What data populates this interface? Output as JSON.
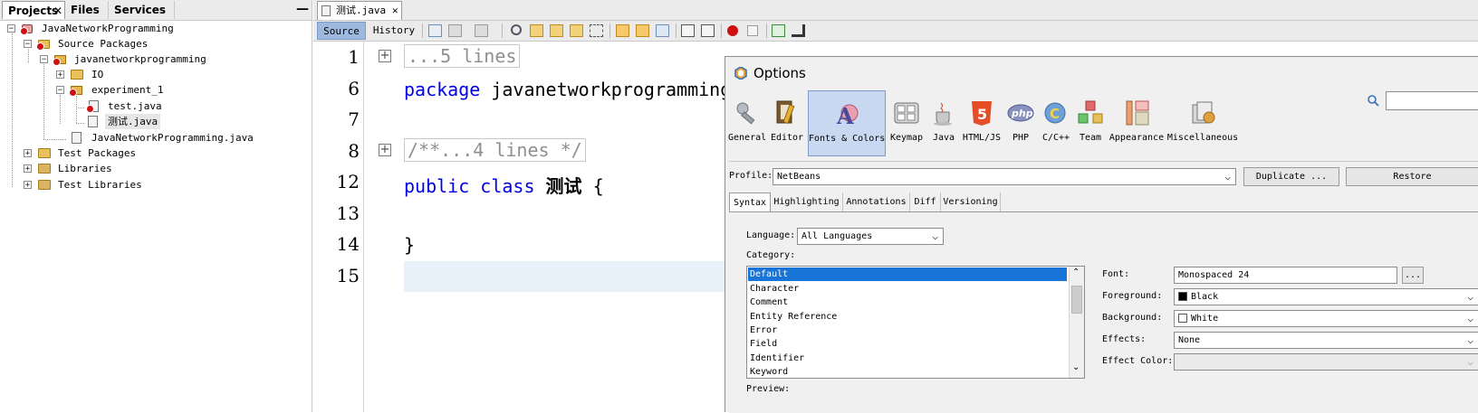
{
  "left_panel": {
    "tabs": [
      {
        "label": "Projects",
        "active": true,
        "close": "✕"
      },
      {
        "label": "Files",
        "active": false
      },
      {
        "label": "Services",
        "active": false
      }
    ],
    "minimize": "—",
    "tree": [
      {
        "label": "JavaNetworkProgramming",
        "level": 0,
        "expander": "−",
        "icon": "java-project-error-icon"
      },
      {
        "label": "Source Packages",
        "level": 1,
        "expander": "−",
        "icon": "source-packages-error-icon"
      },
      {
        "label": "javanetworkprogramming",
        "level": 2,
        "expander": "−",
        "icon": "package-error-icon"
      },
      {
        "label": "IO",
        "level": 3,
        "expander": "+",
        "icon": "folder-icon"
      },
      {
        "label": "experiment_1",
        "level": 3,
        "expander": "−",
        "icon": "package-error-icon"
      },
      {
        "label": "test.java",
        "level": 4,
        "icon": "java-file-error-icon"
      },
      {
        "label": "测试.java",
        "level": 4,
        "icon": "java-file-icon",
        "selected": true
      },
      {
        "label": "JavaNetworkProgramming.java",
        "level": 3,
        "icon": "java-file-icon"
      },
      {
        "label": "Test Packages",
        "level": 1,
        "expander": "+",
        "icon": "test-packages-icon"
      },
      {
        "label": "Libraries",
        "level": 1,
        "expander": "+",
        "icon": "libraries-icon"
      },
      {
        "label": "Test Libraries",
        "level": 1,
        "expander": "+",
        "icon": "test-libraries-icon"
      }
    ]
  },
  "editor": {
    "tab": {
      "label": "测试.java",
      "close": "✕"
    },
    "view_buttons": {
      "source": "Source",
      "history": "History"
    },
    "lines": [
      {
        "num": "1",
        "fold": "+",
        "text": "...5 lines"
      },
      {
        "num": "6",
        "kw": "package",
        "text": "javanetworkprogramming."
      },
      {
        "num": "7",
        "text": ""
      },
      {
        "num": "8",
        "fold": "+",
        "text": "/**...4 lines */"
      },
      {
        "num": "12",
        "kw": "public class",
        "ident": "测试",
        "text": "{"
      },
      {
        "num": "13",
        "text": ""
      },
      {
        "num": "14",
        "text": "}"
      },
      {
        "num": "15",
        "text": ""
      }
    ]
  },
  "options": {
    "title": "Options",
    "categories": [
      {
        "label": "General",
        "icon": "general-wrench-icon"
      },
      {
        "label": "Editor",
        "icon": "editor-icon"
      },
      {
        "label": "Fonts & Colors",
        "icon": "fonts-colors-icon",
        "active": true
      },
      {
        "label": "Keymap",
        "icon": "keymap-icon"
      },
      {
        "label": "Java",
        "icon": "java-cup-icon"
      },
      {
        "label": "HTML/JS",
        "icon": "html5-icon"
      },
      {
        "label": "PHP",
        "icon": "php-icon"
      },
      {
        "label": "C/C++",
        "icon": "cpp-icon"
      },
      {
        "label": "Team",
        "icon": "team-icon"
      },
      {
        "label": "Appearance",
        "icon": "appearance-icon"
      },
      {
        "label": "Miscellaneous",
        "icon": "miscellaneous-icon"
      }
    ],
    "profile_label": "Profile:",
    "profile_value": "NetBeans",
    "duplicate_button": "Duplicate ...",
    "restore_button": "Restore",
    "subtabs": [
      "Syntax",
      "Highlighting",
      "Annotations",
      "Diff",
      "Versioning"
    ],
    "language_label": "Language:",
    "language_value": "All Languages",
    "category_label": "Category:",
    "category_items": [
      "Default",
      "Character",
      "Comment",
      "Entity Reference",
      "Error",
      "Field",
      "Identifier",
      "Keyword"
    ],
    "font_label": "Font:",
    "font_value": "Monospaced 24",
    "font_browse": "...",
    "foreground_label": "Foreground:",
    "foreground_value": "Black",
    "background_label": "Background:",
    "background_value": "White",
    "effects_label": "Effects:",
    "effects_value": "None",
    "effect_color_label": "Effect Color:",
    "effect_color_value": "",
    "preview_label": "Preview:"
  },
  "colors": {
    "keyword": "#0000e6",
    "selection": "#1874d6",
    "active_view": "#9eb9de",
    "current_line": "#e8f0fa",
    "record": "#d01010"
  }
}
